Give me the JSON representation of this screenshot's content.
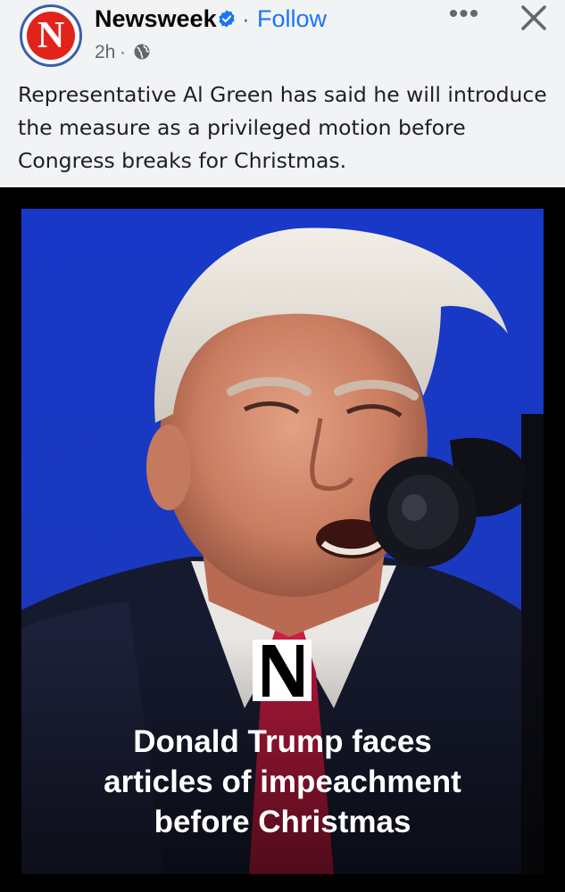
{
  "post": {
    "author": "Newsweek",
    "avatar_letter": "N",
    "follow_label": "Follow",
    "separator": "·",
    "time": "2h",
    "time_separator": "·",
    "privacy_icon": "globe-icon",
    "verified_icon": "verified-badge-icon",
    "more_label": "•••",
    "close_icon": "close-icon",
    "text": "Representative Al Green has said he will introduce the measure as a privileged motion before Congress breaks for Christmas."
  },
  "media": {
    "logo_letter": "N",
    "headline_lines": [
      "Donald Trump faces",
      "articles of impeachment",
      "before Christmas"
    ]
  },
  "colors": {
    "brand_red": "#e2231a",
    "link_blue": "#1877f2",
    "muted_gray": "#65676b",
    "photo_background_blue": "#1838c8"
  }
}
